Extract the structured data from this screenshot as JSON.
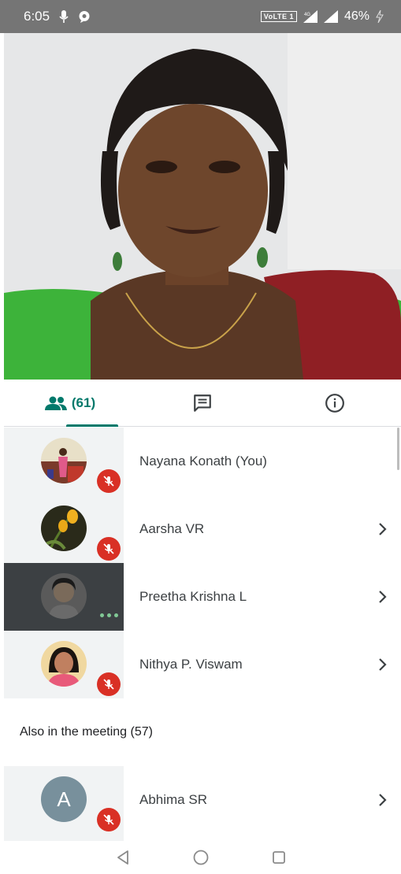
{
  "status_bar": {
    "time": "6:05",
    "volte": "VoLTE 1",
    "network": "4G",
    "battery": "46%"
  },
  "video": {
    "speaker_name": "Nayana Konath"
  },
  "tabs": {
    "people_count": "(61)",
    "people_icon": "people-icon",
    "chat_icon": "chat-icon",
    "info_icon": "info-icon"
  },
  "participants": [
    {
      "name": "Nayana Konath (You)",
      "muted": true,
      "has_chevron": false
    },
    {
      "name": "Aarsha VR",
      "muted": true,
      "has_chevron": true
    },
    {
      "name": "Preetha Krishna L",
      "muted": false,
      "speaking": true,
      "has_chevron": true
    },
    {
      "name": "Nithya P. Viswam",
      "muted": true,
      "has_chevron": true
    }
  ],
  "also_section": {
    "title": "Also in the meeting (57)",
    "participants": [
      {
        "name": "Abhima SR",
        "initial": "A",
        "muted": true,
        "has_chevron": true
      }
    ]
  },
  "colors": {
    "accent": "#00796b",
    "mic_off": "#d93025",
    "status_bar": "#757575"
  }
}
